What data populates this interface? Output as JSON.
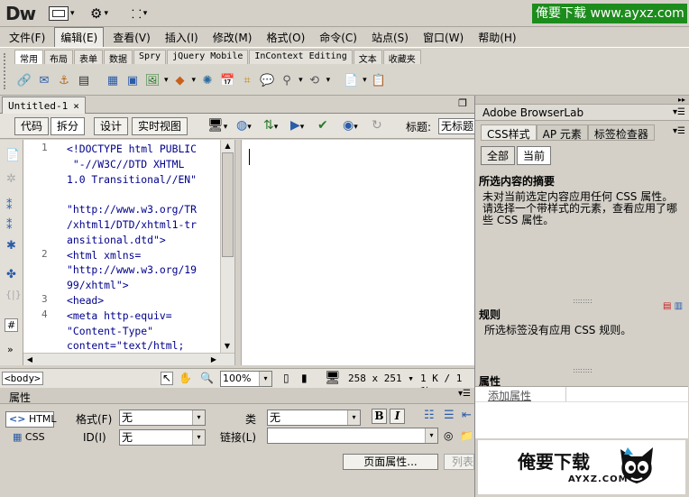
{
  "app": {
    "logo": "Dw",
    "watermark": "俺要下载 www.ayxz.com"
  },
  "menubar": {
    "items": [
      "文件(F)",
      "编辑(E)",
      "查看(V)",
      "插入(I)",
      "修改(M)",
      "格式(O)",
      "命令(C)",
      "站点(S)",
      "窗口(W)",
      "帮助(H)"
    ],
    "active_index": 1
  },
  "insert_bar": {
    "tabs": [
      "常用",
      "布局",
      "表单",
      "数据",
      "Spry",
      "jQuery Mobile",
      "InContext Editing",
      "文本",
      "收藏夹"
    ],
    "active_index": 0
  },
  "document": {
    "tab_title": "Untitled-1",
    "close_glyph": "×",
    "views": [
      "代码",
      "拆分",
      "设计",
      "实时视图"
    ],
    "active_view_index": 1,
    "title_label": "标题:",
    "title_value": "无标题"
  },
  "code": {
    "line_numbers": [
      {
        "num": "1",
        "row": 0
      },
      {
        "num": "2",
        "row": 7
      },
      {
        "num": "3",
        "row": 10
      },
      {
        "num": "4",
        "row": 11
      }
    ],
    "lines": [
      "<!DOCTYPE html PUBLIC",
      " \"-//W3C//DTD XHTML",
      "1.0 Transitional//EN\"",
      "",
      "\"http://www.w3.org/TR",
      "/xhtml1/DTD/xhtml1-tr",
      "ansitional.dtd\">",
      "<html xmlns=",
      "\"http://www.w3.org/19",
      "99/xhtml\">",
      "<head>",
      "<meta http-equiv=",
      "\"Content-Type\"",
      "content=\"text/html;"
    ]
  },
  "statusbar": {
    "tag": "<body>",
    "zoom": "100%",
    "size": "258 x 251",
    "file": "1 K / 1 秒"
  },
  "properties": {
    "title": "属性",
    "html_btn": "HTML",
    "css_btn": "CSS",
    "format_label": "格式(F)",
    "format_value": "无",
    "class_label": "类",
    "class_value": "无",
    "id_label": "ID(I)",
    "id_value": "无",
    "link_label": "链接(L)",
    "link_value": "",
    "bold": "B",
    "italic": "I",
    "page_props_btn": "页面属性...",
    "list_btn": "列表"
  },
  "right_panel": {
    "browserlab": "Adobe BrowserLab",
    "tabs": [
      "CSS样式",
      "AP 元素",
      "标签检查器"
    ],
    "active_tab": 0,
    "mode_buttons": [
      "全部",
      "当前"
    ],
    "active_mode": 1,
    "summary_title": "所选内容的摘要",
    "summary_text": "未对当前选定内容应用任何 CSS 属性。请选择一个带样式的元素，查看应用了哪些 CSS 属性。",
    "rules_title": "规则",
    "rules_text": "所选标签没有应用 CSS 规则。",
    "props_title": "属性",
    "add_property": "添加属性",
    "brand_text": "俺要下载",
    "brand_domain": "AYXZ.COM"
  }
}
